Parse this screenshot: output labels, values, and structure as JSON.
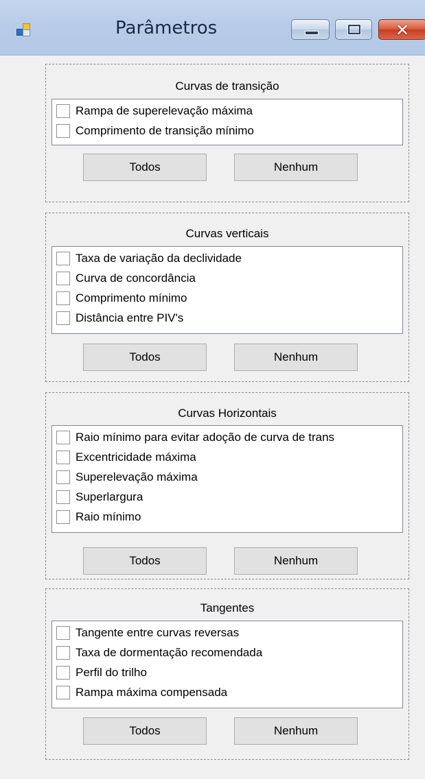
{
  "window": {
    "title": "Parâmetros",
    "icon": "app-icon",
    "caption_buttons": [
      "minimize-icon",
      "maximize-icon",
      "close-icon"
    ]
  },
  "groups": [
    {
      "title": "Curvas de transição",
      "items": [
        "Rampa de superelevação máxima",
        "Comprimento de transição mínimo"
      ],
      "buttons": {
        "all": "Todos",
        "none": "Nenhum"
      }
    },
    {
      "title": "Curvas verticais",
      "items": [
        "Taxa de variação da declividade",
        "Curva de concordância",
        "Comprimento mínimo",
        "Distância entre PIV's"
      ],
      "buttons": {
        "all": "Todos",
        "none": "Nenhum"
      }
    },
    {
      "title": "Curvas Horizontais",
      "items": [
        "Raio mínimo para evitar adoção de curva de trans",
        "Excentricidade máxima",
        "Superelevação máxima",
        "Superlargura",
        "Raio mínimo"
      ],
      "buttons": {
        "all": "Todos",
        "none": "Nenhum"
      }
    },
    {
      "title": "Tangentes",
      "items": [
        "Tangente entre curvas reversas",
        "Taxa de dormentação recomendada",
        "Perfil do trilho",
        "Rampa máxima compensada"
      ],
      "buttons": {
        "all": "Todos",
        "none": "Nenhum"
      }
    }
  ]
}
